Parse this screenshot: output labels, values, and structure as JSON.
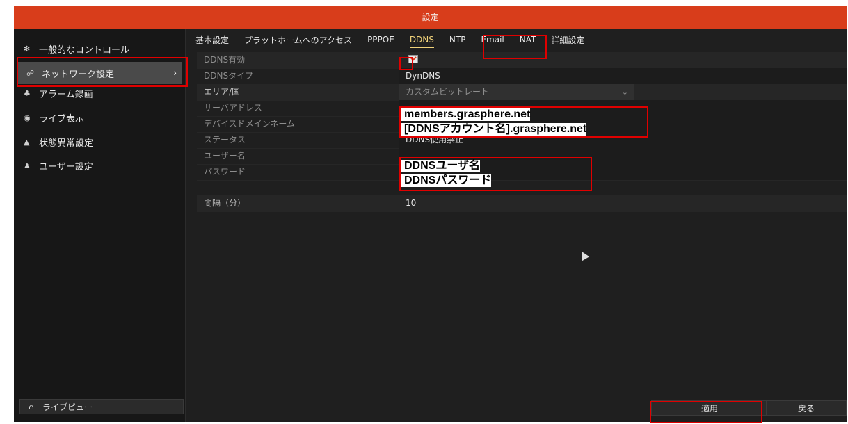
{
  "window": {
    "title": "設定"
  },
  "sidebar": {
    "items": [
      {
        "icon": "gear-icon",
        "glyph": "✻",
        "label": "一般的なコントロール"
      },
      {
        "icon": "network-icon",
        "glyph": "☍",
        "label": "ネットワーク設定"
      },
      {
        "icon": "alarm-icon",
        "glyph": "♣",
        "label": "アラーム録画"
      },
      {
        "icon": "eye-icon",
        "glyph": "◉",
        "label": "ライブ表示"
      },
      {
        "icon": "warning-icon",
        "glyph": "▲",
        "label": "状態異常設定"
      },
      {
        "icon": "users-icon",
        "glyph": "♟",
        "label": "ユーザー設定"
      }
    ],
    "active_chevron": "›",
    "live_view": {
      "icon": "home-icon",
      "glyph": "⌂",
      "label": "ライブビュー"
    }
  },
  "tabs": [
    "基本設定",
    "プラットホームへのアクセス",
    "PPPOE",
    "DDNS",
    "NTP",
    "Email",
    "NAT",
    "詳細設定"
  ],
  "active_tab": "DDNS",
  "form": {
    "ddns_enabled": {
      "label": "DDNS有効",
      "checked": true
    },
    "ddns_type": {
      "label": "DDNSタイプ",
      "value": "DynDNS"
    },
    "area": {
      "label": "エリア/国",
      "value": "カスタムビットレート",
      "caret": "⌄"
    },
    "server_address": {
      "label": "サーバアドレス",
      "value": "members.grasphere.net"
    },
    "device_domain": {
      "label": "デバイスドメインネーム",
      "value": "[DDNSアカウント名].grasphere.net"
    },
    "status": {
      "label": "ステータス",
      "value": "DDNS使用禁止"
    },
    "username": {
      "label": "ユーザー名",
      "value": "DDNSユーザ名"
    },
    "password": {
      "label": "パスワード",
      "value": "DDNSパスワード"
    },
    "interval": {
      "label": "間隔（分）",
      "value": "10"
    }
  },
  "buttons": {
    "apply": "適用",
    "back": "戻る"
  },
  "colors": {
    "title_bar": "#d83d1b",
    "active_tab": "#f0d27a",
    "annotation_box": "#e00000"
  }
}
